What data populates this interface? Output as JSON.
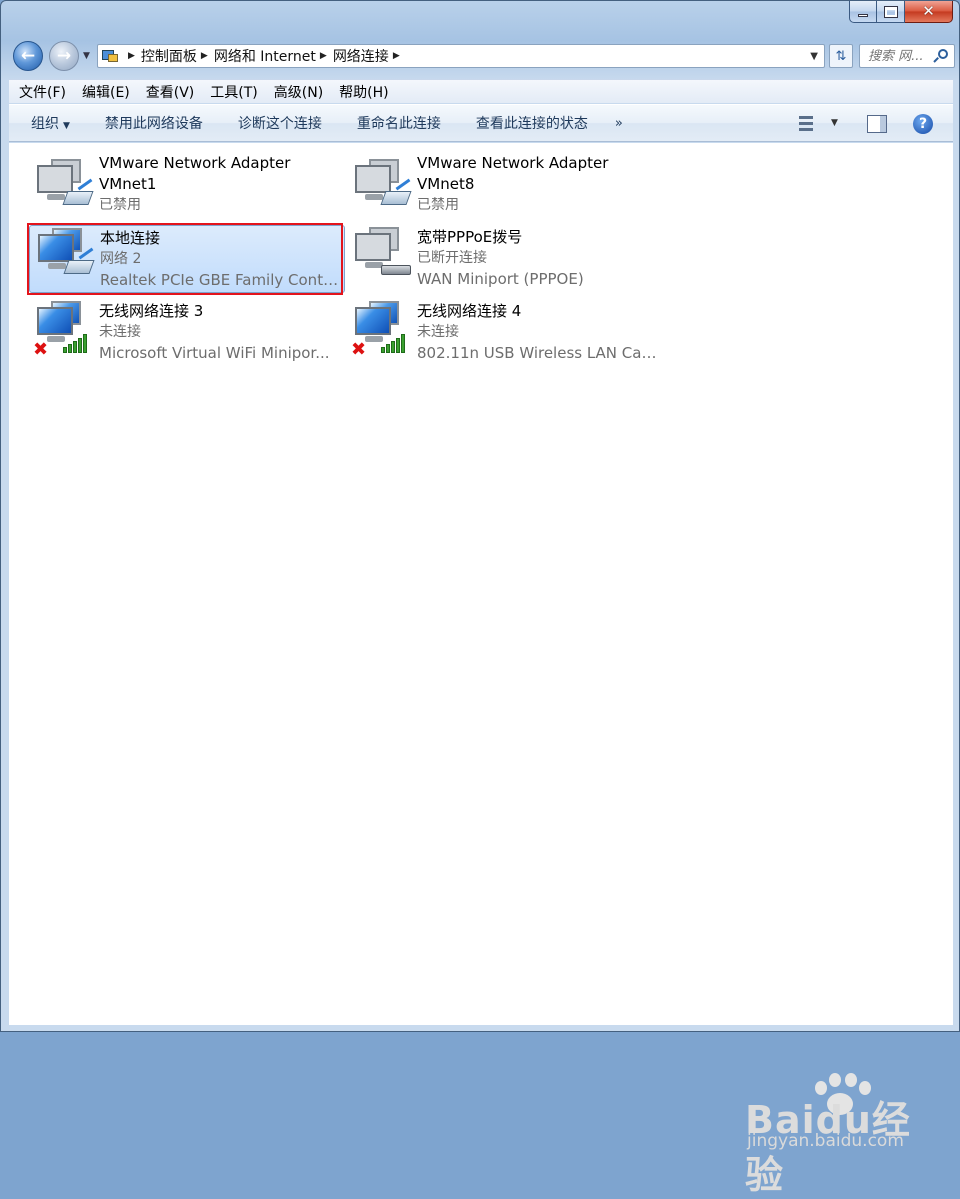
{
  "window": {
    "caption_close": "✕"
  },
  "nav": {
    "back_icon": "back-arrow-icon",
    "forward_icon": "forward-arrow-icon"
  },
  "address": {
    "breadcrumbs": [
      "控制面板",
      "网络和 Internet",
      "网络连接"
    ]
  },
  "search": {
    "placeholder": "搜索 网..."
  },
  "menubar": {
    "items": [
      "文件(F)",
      "编辑(E)",
      "查看(V)",
      "工具(T)",
      "高级(N)",
      "帮助(H)"
    ]
  },
  "toolbar": {
    "organize": "组织",
    "commands": [
      "禁用此网络设备",
      "诊断这个连接",
      "重命名此连接",
      "查看此连接的状态"
    ],
    "more": "»",
    "help": "?"
  },
  "connections": [
    {
      "name": "VMware Network Adapter VMnet1",
      "name_line1": "VMware Network Adapter",
      "name_line2": "VMnet1",
      "status": "已禁用",
      "device": "",
      "state": "disabled",
      "icon": "network-adapter-disabled-icon"
    },
    {
      "name": "VMware Network Adapter VMnet8",
      "name_line1": "VMware Network Adapter",
      "name_line2": "VMnet8",
      "status": "已禁用",
      "device": "",
      "state": "disabled",
      "icon": "network-adapter-disabled-icon"
    },
    {
      "name": "本地连接",
      "status": "网络  2",
      "device": "Realtek PCIe GBE Family Contr...",
      "state": "connected",
      "selected": true,
      "icon": "local-connection-icon"
    },
    {
      "name": "宽带PPPoE拨号",
      "status": "已断开连接",
      "device": "WAN Miniport (PPPOE)",
      "state": "disconnected",
      "icon": "broadband-modem-icon"
    },
    {
      "name": "无线网络连接 3",
      "status": "未连接",
      "device": "Microsoft Virtual WiFi Minipor...",
      "state": "not-connected",
      "icon": "wireless-connection-icon"
    },
    {
      "name": "无线网络连接 4",
      "status": "未连接",
      "device": "802.11n USB Wireless LAN Car...",
      "state": "not-connected",
      "icon": "wireless-connection-icon"
    }
  ],
  "watermark": {
    "brand": "Baidu经验",
    "url": "jingyan.baidu.com"
  },
  "colors": {
    "selection_fill": "#c1dcfc",
    "highlight_frame": "#e3141c",
    "status_gray": "#6d6d6d"
  }
}
